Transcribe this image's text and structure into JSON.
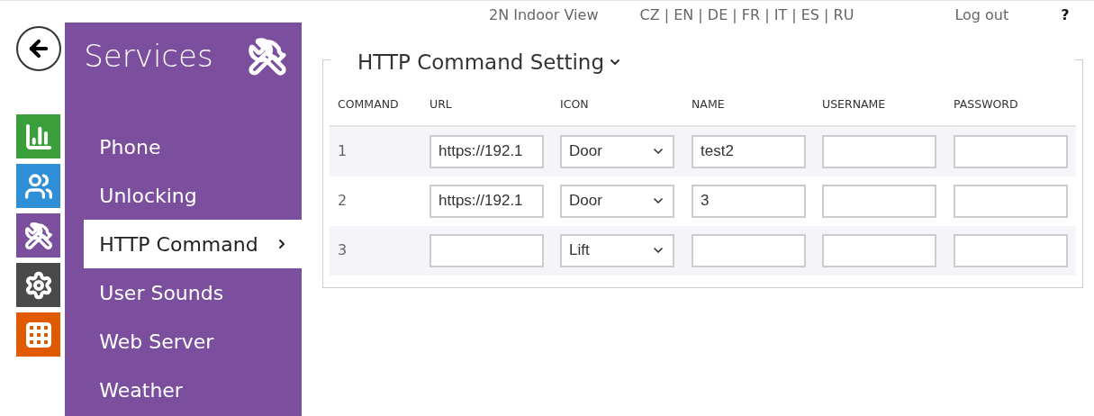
{
  "top_bar": {
    "product": "2N Indoor View",
    "languages": "CZ | EN | DE | FR | IT | ES | RU",
    "logout": "Log out",
    "help": "?"
  },
  "left_nav": [
    {
      "kind": "back"
    },
    {
      "kind": "chart",
      "color": "#3a9f3a"
    },
    {
      "kind": "users",
      "color": "#2f8fd6"
    },
    {
      "kind": "tools",
      "color": "#7b4f9e"
    },
    {
      "kind": "gear",
      "color": "#4a4a4a"
    },
    {
      "kind": "grid",
      "color": "#e05a00"
    }
  ],
  "sidebar": {
    "title": "Services",
    "items": [
      {
        "label": "Phone",
        "selected": false
      },
      {
        "label": "Unlocking",
        "selected": false
      },
      {
        "label": "HTTP Command",
        "selected": true
      },
      {
        "label": "User Sounds",
        "selected": false
      },
      {
        "label": "Web Server",
        "selected": false
      },
      {
        "label": "Weather",
        "selected": false
      }
    ]
  },
  "section": {
    "title": "HTTP Command Setting",
    "expanded": true,
    "table": {
      "columns": [
        "COMMAND",
        "URL",
        "ICON",
        "NAME",
        "USERNAME",
        "PASSWORD"
      ],
      "rows": [
        {
          "command": "1",
          "url": "https://192.1",
          "icon": "Door",
          "name": "test2",
          "username": "",
          "password": ""
        },
        {
          "command": "2",
          "url": "https://192.1",
          "icon": "Door",
          "name": "3",
          "username": "",
          "password": ""
        },
        {
          "command": "3",
          "url": "",
          "icon": "Lift",
          "name": "",
          "username": "",
          "password": ""
        }
      ]
    }
  }
}
